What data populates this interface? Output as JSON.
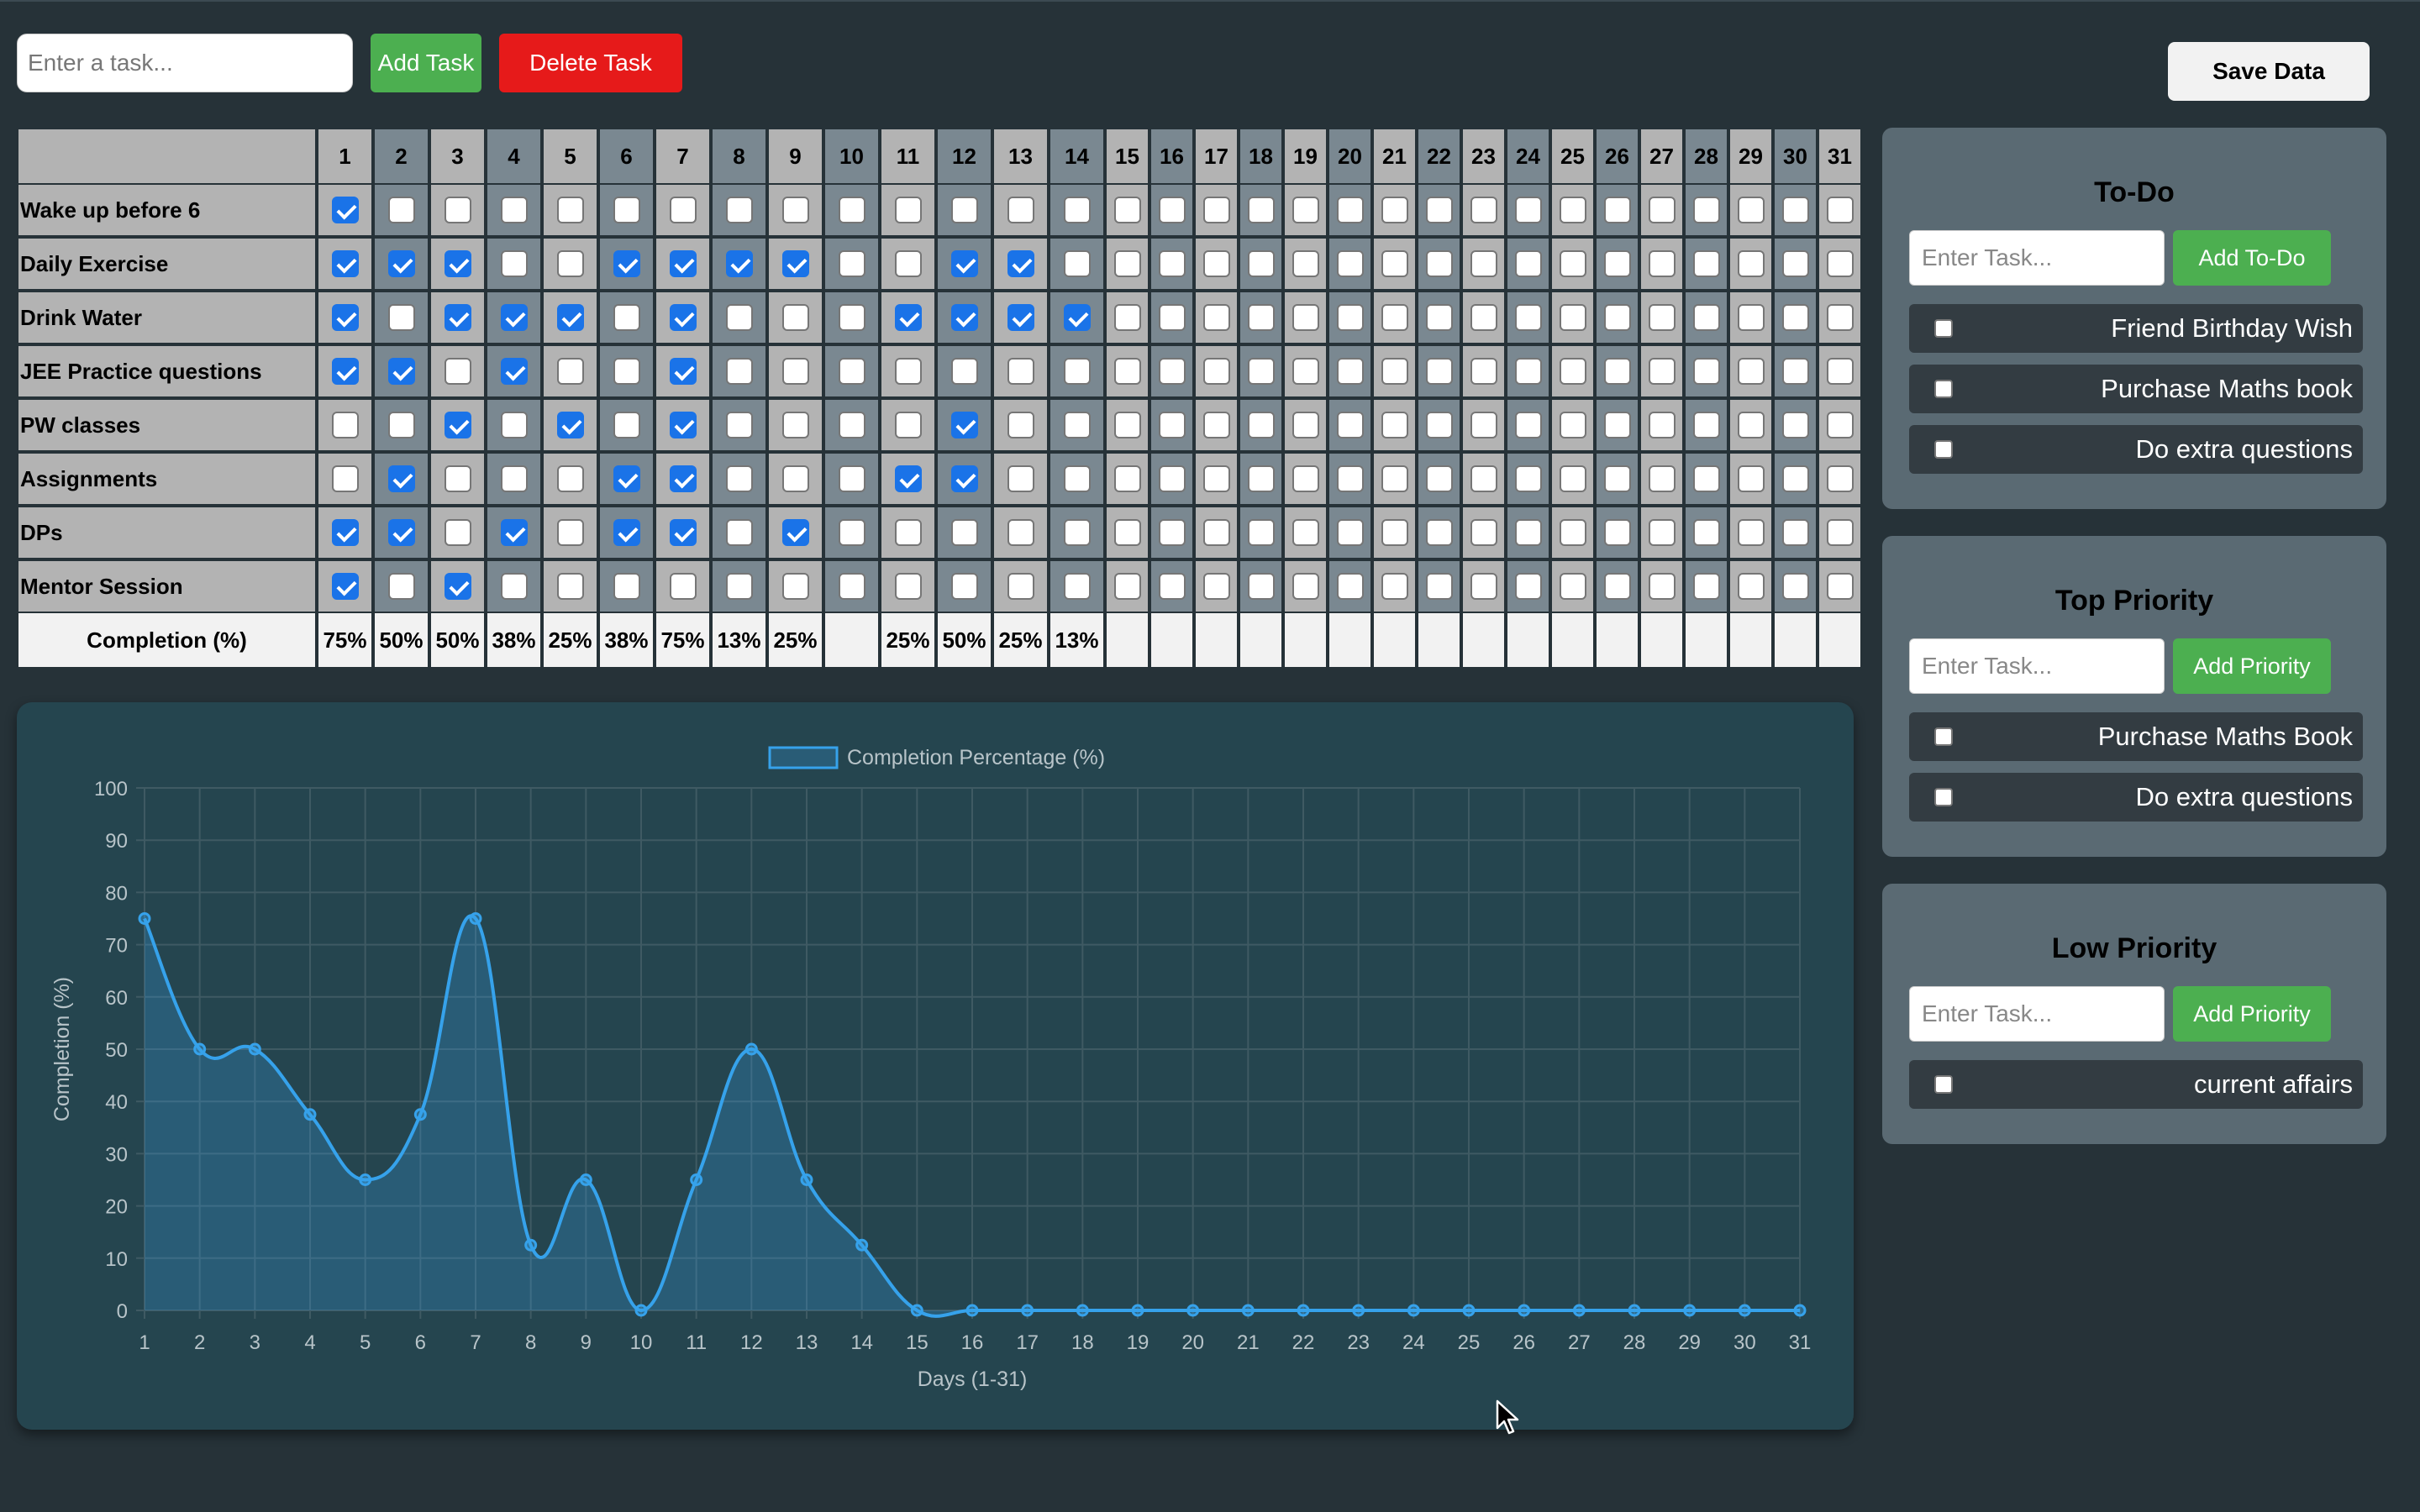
{
  "toolbar": {
    "task_placeholder": "Enter a task...",
    "add_task_label": "Add Task",
    "delete_task_label": "Delete Task",
    "save_label": "Save Data"
  },
  "tracker": {
    "days": [
      "1",
      "2",
      "3",
      "4",
      "5",
      "6",
      "7",
      "8",
      "9",
      "10",
      "11",
      "12",
      "13",
      "14",
      "15",
      "16",
      "17",
      "18",
      "19",
      "20",
      "21",
      "22",
      "23",
      "24",
      "25",
      "26",
      "27",
      "28",
      "29",
      "30",
      "31"
    ],
    "completion_label": "Completion (%)",
    "habits": [
      {
        "name": "Wake up before 6",
        "checked": [
          1
        ]
      },
      {
        "name": "Daily Exercise",
        "checked": [
          1,
          2,
          3,
          6,
          7,
          8,
          9,
          12,
          13
        ]
      },
      {
        "name": "Drink Water",
        "checked": [
          1,
          3,
          4,
          5,
          7,
          11,
          12,
          13,
          14
        ]
      },
      {
        "name": "JEE Practice questions",
        "checked": [
          1,
          2,
          4,
          7
        ]
      },
      {
        "name": "PW classes",
        "checked": [
          3,
          5,
          7,
          12
        ]
      },
      {
        "name": "Assignments",
        "checked": [
          2,
          6,
          7,
          11,
          12
        ]
      },
      {
        "name": "DPs",
        "checked": [
          1,
          2,
          4,
          6,
          7,
          9
        ]
      },
      {
        "name": "Mentor Session",
        "checked": [
          1,
          3
        ]
      }
    ],
    "completion": [
      "75%",
      "50%",
      "50%",
      "38%",
      "25%",
      "38%",
      "75%",
      "13%",
      "25%",
      "",
      "25%",
      "50%",
      "25%",
      "13%",
      "",
      "",
      "",
      "",
      "",
      "",
      "",
      "",
      "",
      "",
      "",
      "",
      "",
      "",
      "",
      "",
      ""
    ]
  },
  "chart_data": {
    "type": "line",
    "legend": "Completion Percentage (%)",
    "xlabel": "Days (1-31)",
    "ylabel": "Completion (%)",
    "x": [
      1,
      2,
      3,
      4,
      5,
      6,
      7,
      8,
      9,
      10,
      11,
      12,
      13,
      14,
      15,
      16,
      17,
      18,
      19,
      20,
      21,
      22,
      23,
      24,
      25,
      26,
      27,
      28,
      29,
      30,
      31
    ],
    "values": [
      75,
      50,
      50,
      37.5,
      25,
      37.5,
      75,
      12.5,
      25,
      0,
      25,
      50,
      25,
      12.5,
      0,
      0,
      0,
      0,
      0,
      0,
      0,
      0,
      0,
      0,
      0,
      0,
      0,
      0,
      0,
      0,
      0
    ],
    "ylim": [
      0,
      100
    ],
    "yticks": [
      0,
      10,
      20,
      30,
      40,
      50,
      60,
      70,
      80,
      90,
      100
    ],
    "grid": true,
    "legend_position": "top",
    "line_color": "#36a2eb"
  },
  "todo": {
    "title": "To-Do",
    "placeholder": "Enter Task...",
    "button_label": "Add To-Do",
    "items": [
      "Friend Birthday Wish",
      "Purchase Maths book",
      "Do extra questions"
    ]
  },
  "top_priority": {
    "title": "Top Priority",
    "placeholder": "Enter Task...",
    "button_label": "Add Priority",
    "items": [
      "Purchase Maths Book",
      "Do extra questions"
    ]
  },
  "low_priority": {
    "title": "Low Priority",
    "placeholder": "Enter Task...",
    "button_label": "Add Priority",
    "items": [
      "current affairs"
    ]
  }
}
